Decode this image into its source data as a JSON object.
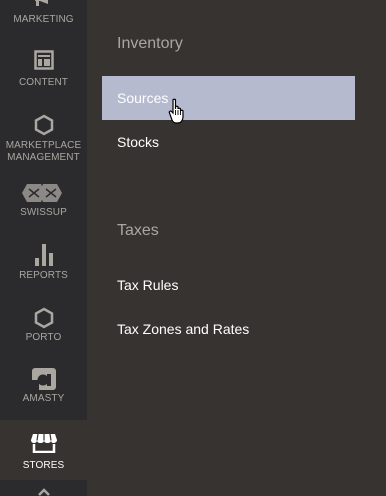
{
  "sidebar": {
    "items": [
      {
        "label": "MARKETING",
        "icon": "megaphone-icon"
      },
      {
        "label": "CONTENT",
        "icon": "layout-icon"
      },
      {
        "label": "MARKETPLACE MANAGEMENT",
        "icon": "hexagon-icon"
      },
      {
        "label": "SWISSUP",
        "icon": "swissup-logo-icon"
      },
      {
        "label": "REPORTS",
        "icon": "bar-chart-icon"
      },
      {
        "label": "PORTO",
        "icon": "hexagon-icon"
      },
      {
        "label": "AMASTY",
        "icon": "amasty-logo-icon"
      },
      {
        "label": "STORES",
        "icon": "storefront-icon"
      }
    ],
    "active": "STORES"
  },
  "panel": {
    "sections": [
      {
        "title": "Inventory",
        "links": [
          "Sources",
          "Stocks"
        ]
      },
      {
        "title": "Taxes",
        "links": [
          "Tax Rules",
          "Tax Zones and Rates"
        ]
      }
    ]
  },
  "colors": {
    "sidebar_bg": "#2b2b2e",
    "panel_bg": "#373330",
    "hover_bg": "#b5bace",
    "text_muted": "#aaa6a0"
  }
}
